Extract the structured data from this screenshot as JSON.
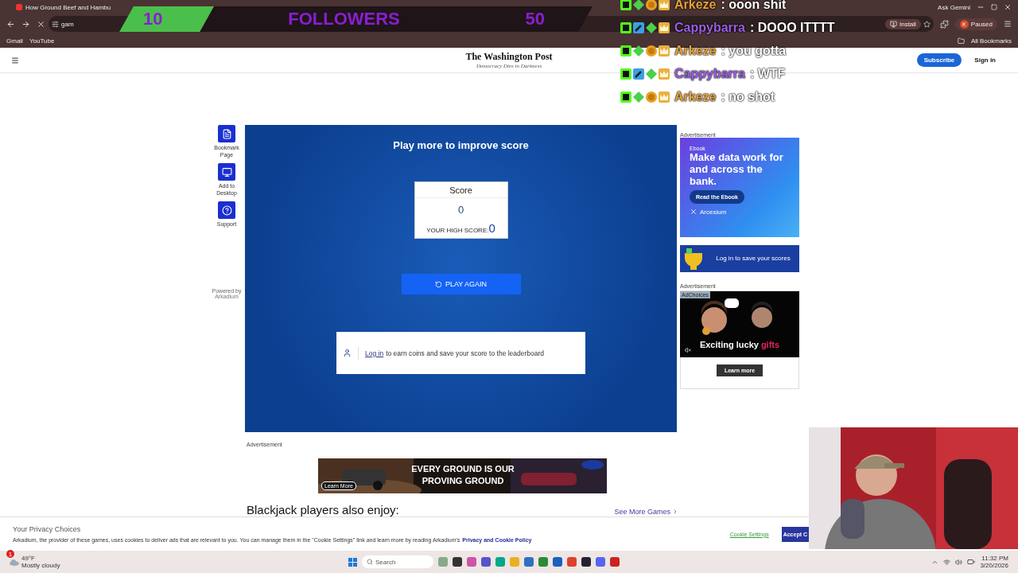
{
  "browser": {
    "tab_title": "How Ground Beef and Hambu",
    "url": "gam",
    "gemini": "Ask Gemini",
    "install": "Install",
    "profile": {
      "initial": "K",
      "label": "Paused"
    },
    "bookmarks": [
      "Gmail",
      "YouTube"
    ],
    "all_bookmarks": "All Bookmarks"
  },
  "site_header": {
    "logo": "The Washington Post",
    "tagline": "Democracy Dies in Darkness",
    "subscribe": "Subscribe",
    "sign_in": "Sign in"
  },
  "game_sidebar": {
    "items": [
      {
        "kind": "bookmark",
        "label": "Bookmark Page"
      },
      {
        "kind": "desktop",
        "label": "Add to Desktop"
      },
      {
        "kind": "support",
        "label": "Support"
      }
    ],
    "powered_by": "Powered by",
    "brand": "Arkadium"
  },
  "game": {
    "title": "Play more to improve score",
    "score_label": "Score",
    "score": "0",
    "high_score_label": "YOUR HIGH SCORE:",
    "high_score": "0",
    "play_again": "PLAY AGAIN",
    "login_link": "Log in",
    "login_text": "to earn coins and save your score to the leaderboard"
  },
  "ads": {
    "label": "Advertisement",
    "ebook": {
      "tag": "Ebook",
      "headline": "Make data work for and across the bank.",
      "button": "Read the Ebook",
      "brand": "Arcesium"
    },
    "login_promo": "Log in to save your scores",
    "label_2": "Advertisement",
    "video": {
      "adchoices": "AdChoices",
      "headline": "Exciting lucky",
      "highlight": "gifts",
      "button": "Learn more"
    }
  },
  "below": {
    "label": "Advertisement",
    "banner": {
      "headline": "EVERY GROUND IS OUR PROVING GROUND",
      "button": "Learn More"
    },
    "heading": "Blackjack players also enjoy:",
    "see_more": "See More Games"
  },
  "privacy": {
    "title": "Your Privacy Choices",
    "text": "Arkadium, the provider of these games, uses cookies to deliver ads that are relevant to you. You can manage them in the \"Cookie Settings\" link and learn more by reading Arkadium's",
    "link": "Privacy and Cookie Policy",
    "settings": "Cookie Settings",
    "accept": "Accept C"
  },
  "taskbar": {
    "weather_badge": "1",
    "temperature": "49°F",
    "weather": "Mostly cloudy",
    "search": "Search",
    "time": "11:32 PM",
    "date": "3/20/2026"
  },
  "followers_goal": {
    "current": "10",
    "label": "FOLLOWERS",
    "target": "50",
    "level": 0.2
  },
  "chat": [
    {
      "user": "Arkeze",
      "color": "#e8a238",
      "message": ": ooon shit",
      "badges": [
        {
          "kind": "k"
        },
        {
          "kind": "diamond"
        },
        {
          "kind": "coin"
        },
        {
          "kind": "crown"
        }
      ]
    },
    {
      "user": "Cappybarra",
      "color": "#9b5de5",
      "message": ": DOOO ITTTT",
      "badges": [
        {
          "kind": "k"
        },
        {
          "kind": "wrench"
        },
        {
          "kind": "diamond"
        },
        {
          "kind": "crown"
        }
      ]
    },
    {
      "user": "Arkeze",
      "color": "#e8a238",
      "message": ": you gotta",
      "badges": [
        {
          "kind": "k"
        },
        {
          "kind": "diamond"
        },
        {
          "kind": "coin"
        },
        {
          "kind": "crown"
        }
      ]
    },
    {
      "user": "Cappybarra",
      "color": "#9b5de5",
      "message": ": WTF",
      "badges": [
        {
          "kind": "k"
        },
        {
          "kind": "wrench"
        },
        {
          "kind": "diamond"
        },
        {
          "kind": "crown"
        }
      ]
    },
    {
      "user": "Arkeze",
      "color": "#e8a238",
      "message": ": no shot",
      "badges": [
        {
          "kind": "k"
        },
        {
          "kind": "diamond"
        },
        {
          "kind": "coin"
        },
        {
          "kind": "crown"
        }
      ]
    }
  ]
}
